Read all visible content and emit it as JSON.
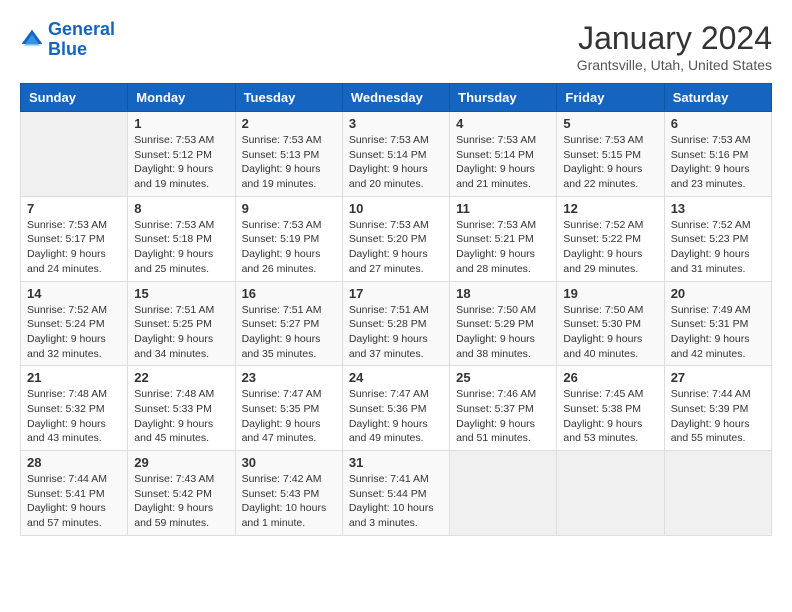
{
  "header": {
    "logo": {
      "line1": "General",
      "line2": "Blue"
    },
    "title": "January 2024",
    "location": "Grantsville, Utah, United States"
  },
  "weekdays": [
    "Sunday",
    "Monday",
    "Tuesday",
    "Wednesday",
    "Thursday",
    "Friday",
    "Saturday"
  ],
  "weeks": [
    [
      {
        "day": "",
        "sunrise": "",
        "sunset": "",
        "daylight": ""
      },
      {
        "day": "1",
        "sunrise": "Sunrise: 7:53 AM",
        "sunset": "Sunset: 5:12 PM",
        "daylight": "Daylight: 9 hours and 19 minutes."
      },
      {
        "day": "2",
        "sunrise": "Sunrise: 7:53 AM",
        "sunset": "Sunset: 5:13 PM",
        "daylight": "Daylight: 9 hours and 19 minutes."
      },
      {
        "day": "3",
        "sunrise": "Sunrise: 7:53 AM",
        "sunset": "Sunset: 5:14 PM",
        "daylight": "Daylight: 9 hours and 20 minutes."
      },
      {
        "day": "4",
        "sunrise": "Sunrise: 7:53 AM",
        "sunset": "Sunset: 5:14 PM",
        "daylight": "Daylight: 9 hours and 21 minutes."
      },
      {
        "day": "5",
        "sunrise": "Sunrise: 7:53 AM",
        "sunset": "Sunset: 5:15 PM",
        "daylight": "Daylight: 9 hours and 22 minutes."
      },
      {
        "day": "6",
        "sunrise": "Sunrise: 7:53 AM",
        "sunset": "Sunset: 5:16 PM",
        "daylight": "Daylight: 9 hours and 23 minutes."
      }
    ],
    [
      {
        "day": "7",
        "sunrise": "Sunrise: 7:53 AM",
        "sunset": "Sunset: 5:17 PM",
        "daylight": "Daylight: 9 hours and 24 minutes."
      },
      {
        "day": "8",
        "sunrise": "Sunrise: 7:53 AM",
        "sunset": "Sunset: 5:18 PM",
        "daylight": "Daylight: 9 hours and 25 minutes."
      },
      {
        "day": "9",
        "sunrise": "Sunrise: 7:53 AM",
        "sunset": "Sunset: 5:19 PM",
        "daylight": "Daylight: 9 hours and 26 minutes."
      },
      {
        "day": "10",
        "sunrise": "Sunrise: 7:53 AM",
        "sunset": "Sunset: 5:20 PM",
        "daylight": "Daylight: 9 hours and 27 minutes."
      },
      {
        "day": "11",
        "sunrise": "Sunrise: 7:53 AM",
        "sunset": "Sunset: 5:21 PM",
        "daylight": "Daylight: 9 hours and 28 minutes."
      },
      {
        "day": "12",
        "sunrise": "Sunrise: 7:52 AM",
        "sunset": "Sunset: 5:22 PM",
        "daylight": "Daylight: 9 hours and 29 minutes."
      },
      {
        "day": "13",
        "sunrise": "Sunrise: 7:52 AM",
        "sunset": "Sunset: 5:23 PM",
        "daylight": "Daylight: 9 hours and 31 minutes."
      }
    ],
    [
      {
        "day": "14",
        "sunrise": "Sunrise: 7:52 AM",
        "sunset": "Sunset: 5:24 PM",
        "daylight": "Daylight: 9 hours and 32 minutes."
      },
      {
        "day": "15",
        "sunrise": "Sunrise: 7:51 AM",
        "sunset": "Sunset: 5:25 PM",
        "daylight": "Daylight: 9 hours and 34 minutes."
      },
      {
        "day": "16",
        "sunrise": "Sunrise: 7:51 AM",
        "sunset": "Sunset: 5:27 PM",
        "daylight": "Daylight: 9 hours and 35 minutes."
      },
      {
        "day": "17",
        "sunrise": "Sunrise: 7:51 AM",
        "sunset": "Sunset: 5:28 PM",
        "daylight": "Daylight: 9 hours and 37 minutes."
      },
      {
        "day": "18",
        "sunrise": "Sunrise: 7:50 AM",
        "sunset": "Sunset: 5:29 PM",
        "daylight": "Daylight: 9 hours and 38 minutes."
      },
      {
        "day": "19",
        "sunrise": "Sunrise: 7:50 AM",
        "sunset": "Sunset: 5:30 PM",
        "daylight": "Daylight: 9 hours and 40 minutes."
      },
      {
        "day": "20",
        "sunrise": "Sunrise: 7:49 AM",
        "sunset": "Sunset: 5:31 PM",
        "daylight": "Daylight: 9 hours and 42 minutes."
      }
    ],
    [
      {
        "day": "21",
        "sunrise": "Sunrise: 7:48 AM",
        "sunset": "Sunset: 5:32 PM",
        "daylight": "Daylight: 9 hours and 43 minutes."
      },
      {
        "day": "22",
        "sunrise": "Sunrise: 7:48 AM",
        "sunset": "Sunset: 5:33 PM",
        "daylight": "Daylight: 9 hours and 45 minutes."
      },
      {
        "day": "23",
        "sunrise": "Sunrise: 7:47 AM",
        "sunset": "Sunset: 5:35 PM",
        "daylight": "Daylight: 9 hours and 47 minutes."
      },
      {
        "day": "24",
        "sunrise": "Sunrise: 7:47 AM",
        "sunset": "Sunset: 5:36 PM",
        "daylight": "Daylight: 9 hours and 49 minutes."
      },
      {
        "day": "25",
        "sunrise": "Sunrise: 7:46 AM",
        "sunset": "Sunset: 5:37 PM",
        "daylight": "Daylight: 9 hours and 51 minutes."
      },
      {
        "day": "26",
        "sunrise": "Sunrise: 7:45 AM",
        "sunset": "Sunset: 5:38 PM",
        "daylight": "Daylight: 9 hours and 53 minutes."
      },
      {
        "day": "27",
        "sunrise": "Sunrise: 7:44 AM",
        "sunset": "Sunset: 5:39 PM",
        "daylight": "Daylight: 9 hours and 55 minutes."
      }
    ],
    [
      {
        "day": "28",
        "sunrise": "Sunrise: 7:44 AM",
        "sunset": "Sunset: 5:41 PM",
        "daylight": "Daylight: 9 hours and 57 minutes."
      },
      {
        "day": "29",
        "sunrise": "Sunrise: 7:43 AM",
        "sunset": "Sunset: 5:42 PM",
        "daylight": "Daylight: 9 hours and 59 minutes."
      },
      {
        "day": "30",
        "sunrise": "Sunrise: 7:42 AM",
        "sunset": "Sunset: 5:43 PM",
        "daylight": "Daylight: 10 hours and 1 minute."
      },
      {
        "day": "31",
        "sunrise": "Sunrise: 7:41 AM",
        "sunset": "Sunset: 5:44 PM",
        "daylight": "Daylight: 10 hours and 3 minutes."
      },
      {
        "day": "",
        "sunrise": "",
        "sunset": "",
        "daylight": ""
      },
      {
        "day": "",
        "sunrise": "",
        "sunset": "",
        "daylight": ""
      },
      {
        "day": "",
        "sunrise": "",
        "sunset": "",
        "daylight": ""
      }
    ]
  ]
}
